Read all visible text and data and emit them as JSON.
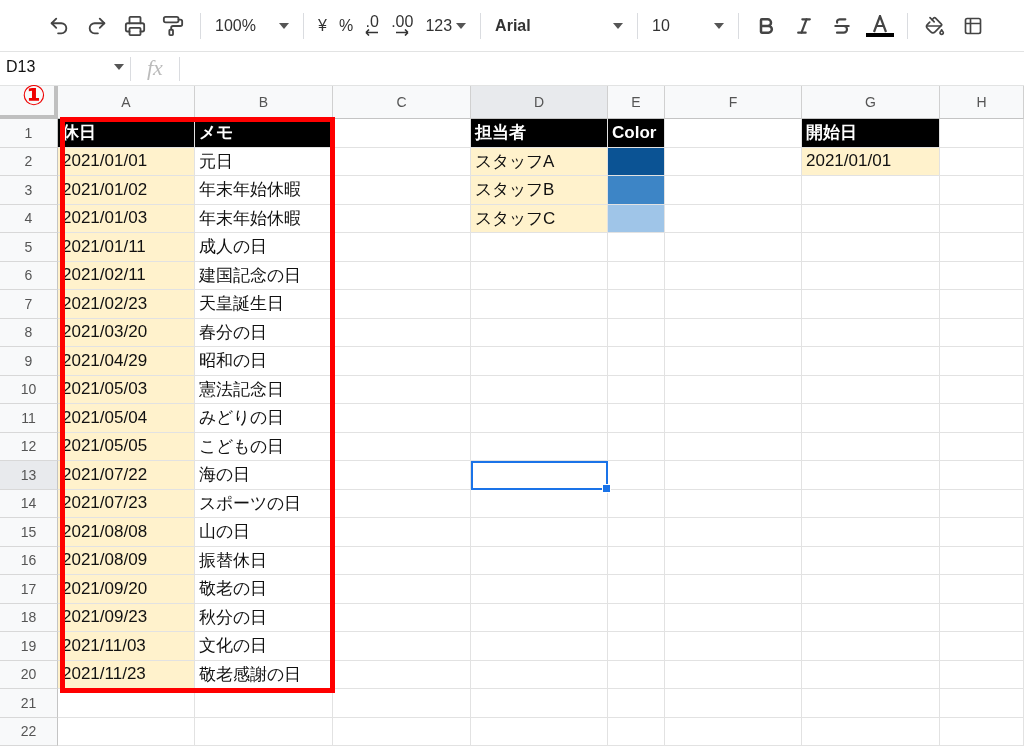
{
  "toolbar": {
    "zoom": "100%",
    "currency": "¥",
    "percent": "%",
    "decrease_decimal": ".0",
    "increase_decimal": ".00",
    "number_format": "123",
    "font": "Arial",
    "font_size": "10"
  },
  "formula_bar": {
    "cell_ref": "D13",
    "fx": "fx"
  },
  "annotation": {
    "label": "①"
  },
  "columns": [
    {
      "label": "A",
      "selected": false
    },
    {
      "label": "B",
      "selected": false
    },
    {
      "label": "C",
      "selected": false
    },
    {
      "label": "D",
      "selected": true
    },
    {
      "label": "E",
      "selected": false
    },
    {
      "label": "F",
      "selected": false
    },
    {
      "label": "G",
      "selected": false
    },
    {
      "label": "H",
      "selected": false
    }
  ],
  "rows": [
    {
      "number": "1",
      "selected": false,
      "cells": [
        {
          "text": "休日",
          "kind": "header",
          "selected": false
        },
        {
          "text": "メモ",
          "kind": "header",
          "selected": false
        },
        null,
        {
          "text": "担当者",
          "kind": "header",
          "selected": false
        },
        {
          "text": "Color",
          "kind": "header",
          "selected": false
        },
        null,
        {
          "text": "開始日",
          "kind": "header",
          "selected": false
        },
        null
      ]
    },
    {
      "number": "2",
      "selected": false,
      "cells": [
        {
          "text": "2021/01/01",
          "kind": "input",
          "selected": false
        },
        {
          "text": "元日",
          "kind": "plain",
          "selected": false
        },
        null,
        {
          "text": "スタッフA",
          "kind": "input",
          "selected": false
        },
        {
          "kind": "swatch",
          "color": "#0b5394",
          "selected": false
        },
        null,
        {
          "text": "2021/01/01",
          "kind": "input",
          "selected": false
        },
        null
      ]
    },
    {
      "number": "3",
      "selected": false,
      "cells": [
        {
          "text": "2021/01/02",
          "kind": "input",
          "selected": false
        },
        {
          "text": "年末年始休暇",
          "kind": "plain",
          "selected": false
        },
        null,
        {
          "text": "スタッフB",
          "kind": "input",
          "selected": false
        },
        {
          "kind": "swatch",
          "color": "#3d85c6",
          "selected": false
        },
        null,
        null,
        null
      ]
    },
    {
      "number": "4",
      "selected": false,
      "cells": [
        {
          "text": "2021/01/03",
          "kind": "input",
          "selected": false
        },
        {
          "text": "年末年始休暇",
          "kind": "plain",
          "selected": false
        },
        null,
        {
          "text": "スタッフC",
          "kind": "input",
          "selected": false
        },
        {
          "kind": "swatch",
          "color": "#9fc5e8",
          "selected": false
        },
        null,
        null,
        null
      ]
    },
    {
      "number": "5",
      "selected": false,
      "cells": [
        {
          "text": "2021/01/11",
          "kind": "input",
          "selected": false
        },
        {
          "text": "成人の日",
          "kind": "plain",
          "selected": false
        },
        null,
        null,
        null,
        null,
        null,
        null
      ]
    },
    {
      "number": "6",
      "selected": false,
      "cells": [
        {
          "text": "2021/02/11",
          "kind": "input",
          "selected": false
        },
        {
          "text": "建国記念の日",
          "kind": "plain",
          "selected": false
        },
        null,
        null,
        null,
        null,
        null,
        null
      ]
    },
    {
      "number": "7",
      "selected": false,
      "cells": [
        {
          "text": "2021/02/23",
          "kind": "input",
          "selected": false
        },
        {
          "text": "天皇誕生日",
          "kind": "plain",
          "selected": false
        },
        null,
        null,
        null,
        null,
        null,
        null
      ]
    },
    {
      "number": "8",
      "selected": false,
      "cells": [
        {
          "text": "2021/03/20",
          "kind": "input",
          "selected": false
        },
        {
          "text": "春分の日",
          "kind": "plain",
          "selected": false
        },
        null,
        null,
        null,
        null,
        null,
        null
      ]
    },
    {
      "number": "9",
      "selected": false,
      "cells": [
        {
          "text": "2021/04/29",
          "kind": "input",
          "selected": false
        },
        {
          "text": "昭和の日",
          "kind": "plain",
          "selected": false
        },
        null,
        null,
        null,
        null,
        null,
        null
      ]
    },
    {
      "number": "10",
      "selected": false,
      "cells": [
        {
          "text": "2021/05/03",
          "kind": "input",
          "selected": false
        },
        {
          "text": "憲法記念日",
          "kind": "plain",
          "selected": false
        },
        null,
        null,
        null,
        null,
        null,
        null
      ]
    },
    {
      "number": "11",
      "selected": false,
      "cells": [
        {
          "text": "2021/05/04",
          "kind": "input",
          "selected": false
        },
        {
          "text": "みどりの日",
          "kind": "plain",
          "selected": false
        },
        null,
        null,
        null,
        null,
        null,
        null
      ]
    },
    {
      "number": "12",
      "selected": false,
      "cells": [
        {
          "text": "2021/05/05",
          "kind": "input",
          "selected": false
        },
        {
          "text": "こどもの日",
          "kind": "plain",
          "selected": false
        },
        null,
        null,
        null,
        null,
        null,
        null
      ]
    },
    {
      "number": "13",
      "selected": true,
      "cells": [
        {
          "text": "2021/07/22",
          "kind": "input",
          "selected": false
        },
        {
          "text": "海の日",
          "kind": "plain",
          "selected": false
        },
        null,
        {
          "kind": "plain",
          "selected": true
        },
        null,
        null,
        null,
        null
      ]
    },
    {
      "number": "14",
      "selected": false,
      "cells": [
        {
          "text": "2021/07/23",
          "kind": "input",
          "selected": false
        },
        {
          "text": "スポーツの日",
          "kind": "plain",
          "selected": false
        },
        null,
        null,
        null,
        null,
        null,
        null
      ]
    },
    {
      "number": "15",
      "selected": false,
      "cells": [
        {
          "text": "2021/08/08",
          "kind": "input",
          "selected": false
        },
        {
          "text": "山の日",
          "kind": "plain",
          "selected": false
        },
        null,
        null,
        null,
        null,
        null,
        null
      ]
    },
    {
      "number": "16",
      "selected": false,
      "cells": [
        {
          "text": "2021/08/09",
          "kind": "input",
          "selected": false
        },
        {
          "text": "振替休日",
          "kind": "plain",
          "selected": false
        },
        null,
        null,
        null,
        null,
        null,
        null
      ]
    },
    {
      "number": "17",
      "selected": false,
      "cells": [
        {
          "text": "2021/09/20",
          "kind": "input",
          "selected": false
        },
        {
          "text": "敬老の日",
          "kind": "plain",
          "selected": false
        },
        null,
        null,
        null,
        null,
        null,
        null
      ]
    },
    {
      "number": "18",
      "selected": false,
      "cells": [
        {
          "text": "2021/09/23",
          "kind": "input",
          "selected": false
        },
        {
          "text": "秋分の日",
          "kind": "plain",
          "selected": false
        },
        null,
        null,
        null,
        null,
        null,
        null
      ]
    },
    {
      "number": "19",
      "selected": false,
      "cells": [
        {
          "text": "2021/11/03",
          "kind": "input",
          "selected": false
        },
        {
          "text": "文化の日",
          "kind": "plain",
          "selected": false
        },
        null,
        null,
        null,
        null,
        null,
        null
      ]
    },
    {
      "number": "20",
      "selected": false,
      "cells": [
        {
          "text": "2021/11/23",
          "kind": "input",
          "selected": false
        },
        {
          "text": "敬老感謝の日",
          "kind": "plain",
          "selected": false
        },
        null,
        null,
        null,
        null,
        null,
        null
      ]
    },
    {
      "number": "21",
      "selected": false,
      "cells": [
        null,
        null,
        null,
        null,
        null,
        null,
        null,
        null
      ]
    },
    {
      "number": "22",
      "selected": false,
      "cells": [
        null,
        null,
        null,
        null,
        null,
        null,
        null,
        null
      ]
    }
  ]
}
